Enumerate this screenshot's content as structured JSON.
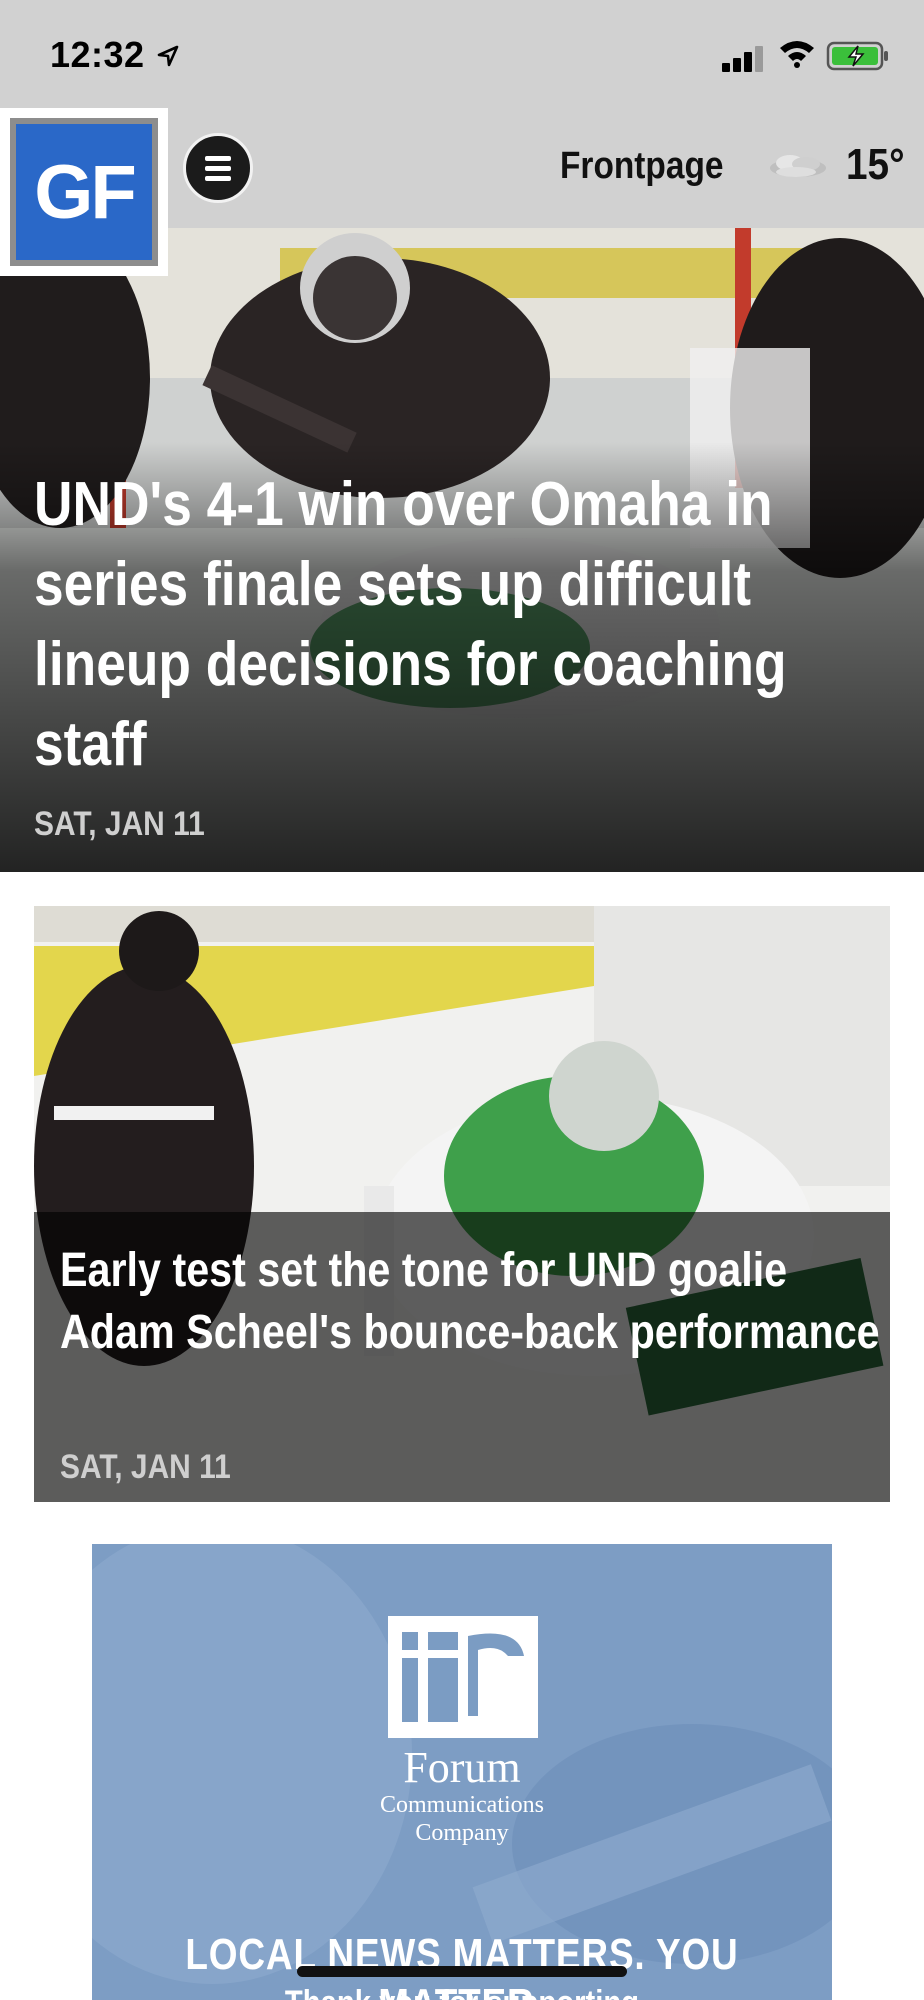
{
  "status_bar": {
    "time": "12:32"
  },
  "header": {
    "logo_text": "GF",
    "section": "Frontpage",
    "temperature": "15°",
    "weather_icon": "cloudy-icon"
  },
  "stories": [
    {
      "headline": "UND's 4-1 win over Omaha in series finale sets up difficult lineup decisions for coaching staff",
      "date": "SAT, JAN 11"
    },
    {
      "headline": "Early test set the tone for UND goalie Adam Scheel's bounce-back performance",
      "date": "SAT, JAN 11"
    }
  ],
  "ad": {
    "brand_name": "Forum",
    "brand_line2": "Communications",
    "brand_line3": "Company",
    "tagline": "LOCAL NEWS MATTERS. YOU MATTER.",
    "sub": "Thank you for supporting"
  },
  "colors": {
    "header_bg": "#d1d1d1",
    "logo_blue": "#2a68c8",
    "ad_blue": "#7b9cc3"
  }
}
